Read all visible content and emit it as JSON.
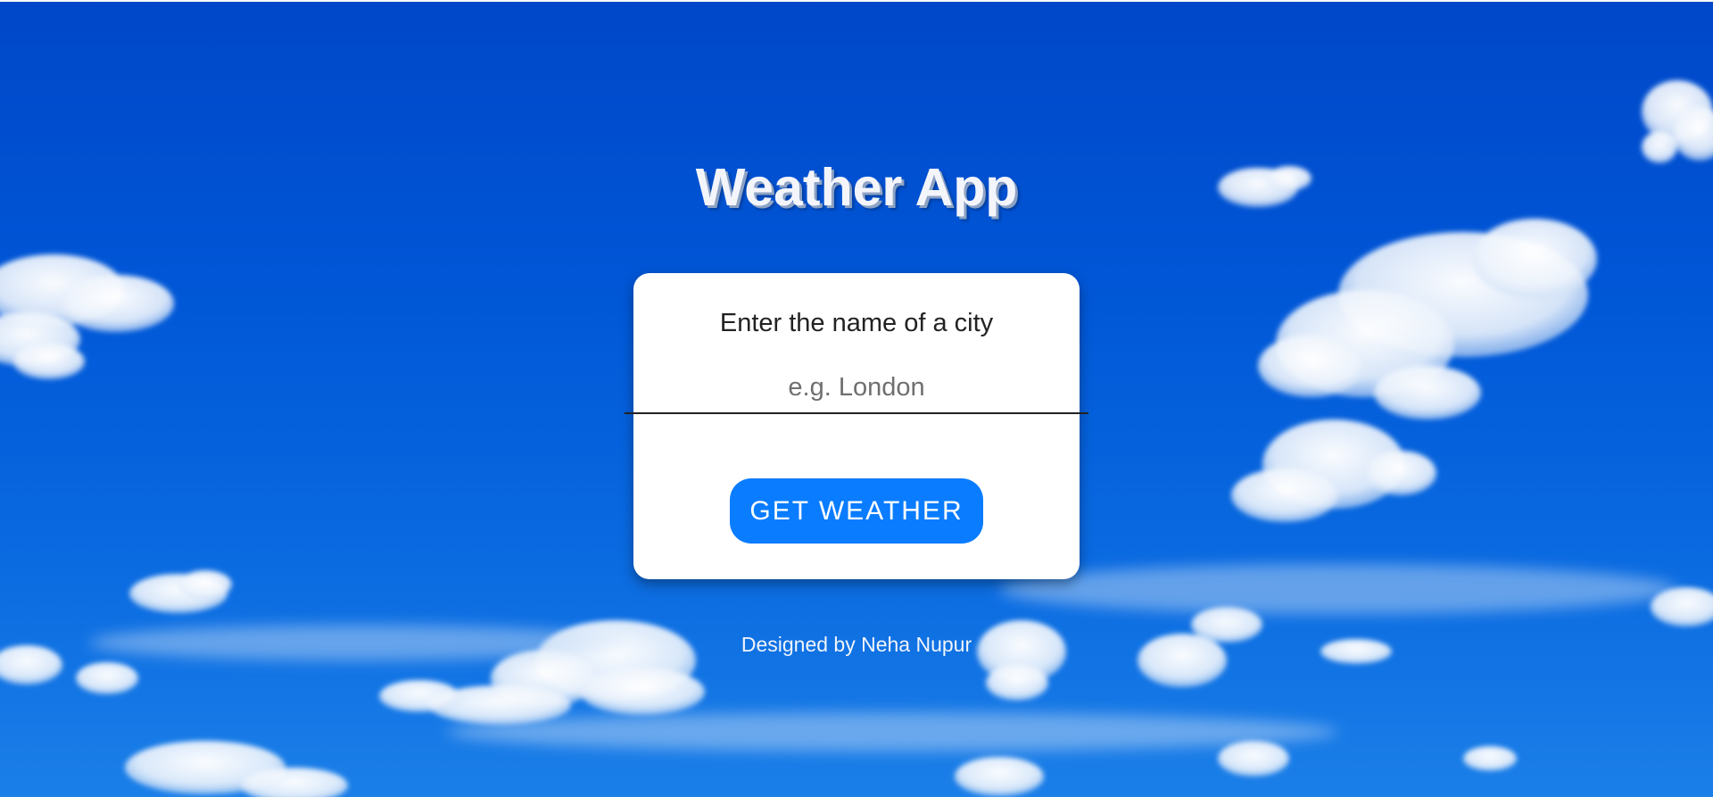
{
  "app": {
    "title": "Weather App"
  },
  "form": {
    "prompt": "Enter the name of a city",
    "city_input": {
      "value": "",
      "placeholder": "e.g. London"
    },
    "submit_label": "GET WEATHER"
  },
  "footer": {
    "credit": "Designed by Neha Nupur"
  },
  "colors": {
    "sky": "#0056d6",
    "button": "#0a7cff",
    "card": "#ffffff"
  },
  "background": {
    "scene": "blue-sky-with-clouds"
  }
}
